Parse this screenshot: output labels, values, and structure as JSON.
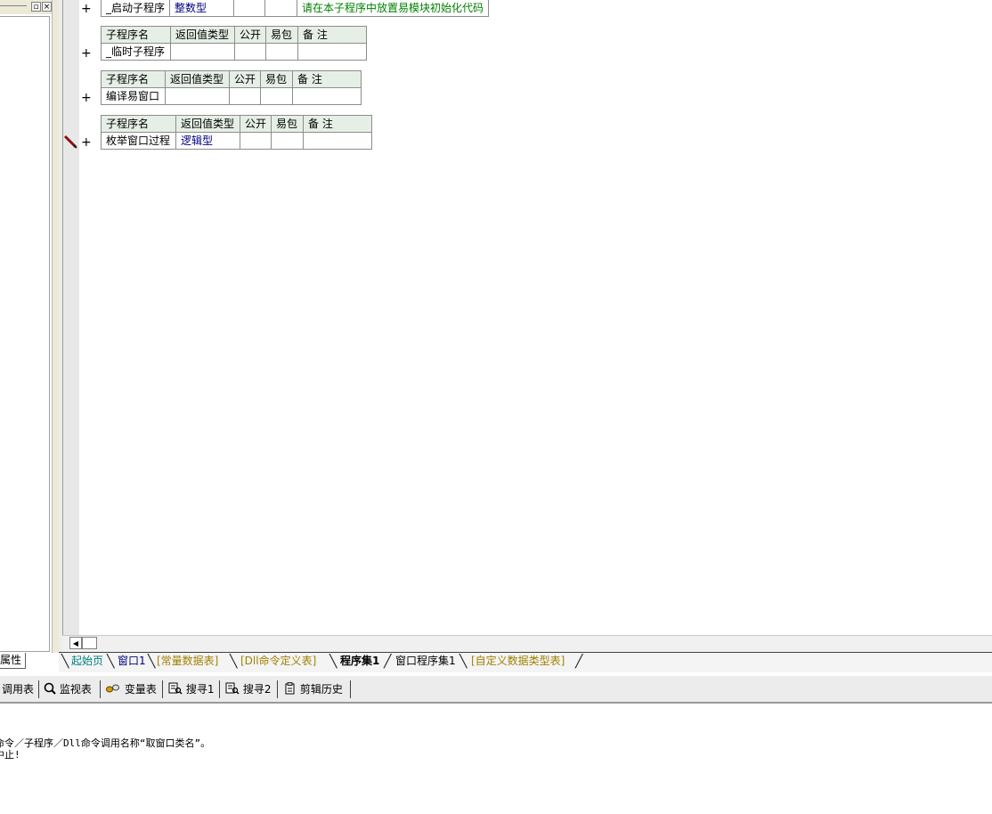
{
  "left_panel": {
    "attr_tab_label": "属性"
  },
  "tables": [
    {
      "headers": [],
      "row": {
        "name": "_启动子程序",
        "return_type": "整数型",
        "public": "",
        "easy_pkg": "",
        "remark": "请在本子程序中放置易模块初始化代码"
      }
    },
    {
      "headers": [
        "子程序名",
        "返回值类型",
        "公开",
        "易包",
        "备 注"
      ],
      "row": {
        "name": "_临时子程序",
        "return_type": "",
        "public": "",
        "easy_pkg": "",
        "remark": ""
      }
    },
    {
      "headers": [
        "子程序名",
        "返回值类型",
        "公开",
        "易包",
        "备 注"
      ],
      "row": {
        "name": "编译易窗口",
        "return_type": "",
        "public": "",
        "easy_pkg": "",
        "remark": ""
      }
    },
    {
      "headers": [
        "子程序名",
        "返回值类型",
        "公开",
        "易包",
        "备 注"
      ],
      "row": {
        "name": "枚举窗口过程",
        "return_type": "逻辑型",
        "public": "",
        "easy_pkg": "",
        "remark": ""
      }
    }
  ],
  "expand_symbol": "+",
  "tabs": [
    {
      "label": "起始页"
    },
    {
      "label": "窗口1"
    },
    {
      "label": "[常量数据表]"
    },
    {
      "label": "[Dll命令定义表]"
    },
    {
      "label": "程序集1"
    },
    {
      "label": "窗口程序集1"
    },
    {
      "label": "[自定义数据类型表]"
    }
  ],
  "toolbar": [
    {
      "label": "调用表",
      "icon": "table-icon"
    },
    {
      "label": "监视表",
      "icon": "magnifier-icon"
    },
    {
      "label": "变量表",
      "icon": "variables-icon"
    },
    {
      "label": "搜寻1",
      "icon": "search-doc-icon"
    },
    {
      "label": "搜寻2",
      "icon": "search-doc-icon"
    },
    {
      "label": "剪辑历史",
      "icon": "clipboard-icon"
    }
  ],
  "output": {
    "line1": "命令／子程序／Dll命令调用名称“取窗口类名”。",
    "line2": "中止!"
  },
  "colors": {
    "header_bg": "#e6efe6",
    "type_text": "#000080",
    "remark_text": "#008000",
    "tab_teal": "#008080",
    "tab_olive": "#a08000"
  }
}
